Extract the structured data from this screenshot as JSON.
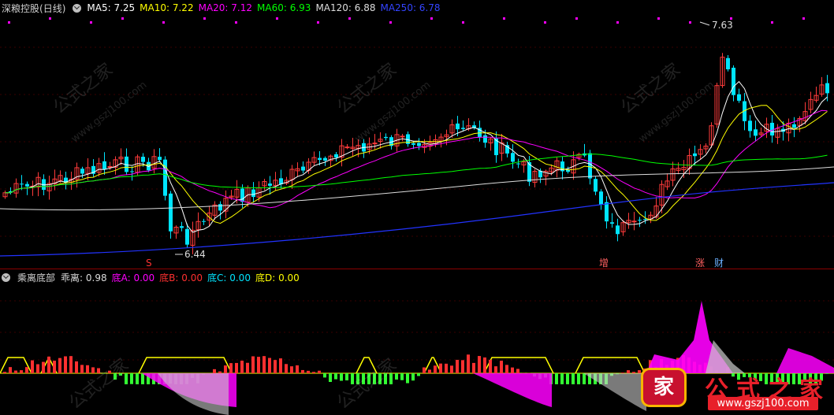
{
  "main_panel": {
    "stock_name": "深粮控股",
    "period": "(日线)",
    "ma": [
      {
        "label": "MA5:",
        "value": "7.25",
        "color": "#ffffff"
      },
      {
        "label": "MA10:",
        "value": "7.22",
        "color": "#ffff00"
      },
      {
        "label": "MA20:",
        "value": "7.12",
        "color": "#ff00ff"
      },
      {
        "label": "MA60:",
        "value": "6.93",
        "color": "#00ff00"
      },
      {
        "label": "MA120:",
        "value": "6.88",
        "color": "#dddddd"
      },
      {
        "label": "MA250:",
        "value": "6.78",
        "color": "#3344ff"
      }
    ],
    "high_label": "7.63",
    "low_label": "6.44",
    "markers": [
      {
        "text": "S",
        "color": "#ff3030"
      },
      {
        "text": "增",
        "color": "#ff6060"
      },
      {
        "text": "涨",
        "color": "#ff6060"
      },
      {
        "text": "财",
        "color": "#6ab0ff"
      }
    ]
  },
  "sub_panel": {
    "indicator_name": "乘离底部",
    "fields": [
      {
        "label": "乖离:",
        "value": "0.98",
        "color": "#dddddd"
      },
      {
        "label": "底A:",
        "value": "0.00",
        "color": "#ff00ff"
      },
      {
        "label": "底B:",
        "value": "0.00",
        "color": "#ff3030"
      },
      {
        "label": "底C:",
        "value": "0.00",
        "color": "#00e5ff"
      },
      {
        "label": "底D:",
        "value": "0.00",
        "color": "#ffff00"
      }
    ]
  },
  "watermark": {
    "text": "公式之家",
    "url": "www.gszj100.com"
  },
  "logo": {
    "badge": "家",
    "text": "公式之家",
    "url": "www.gszj100.com"
  },
  "colors": {
    "up": "#ff3b3b",
    "down": "#00e5ff",
    "background": "#000000"
  }
}
